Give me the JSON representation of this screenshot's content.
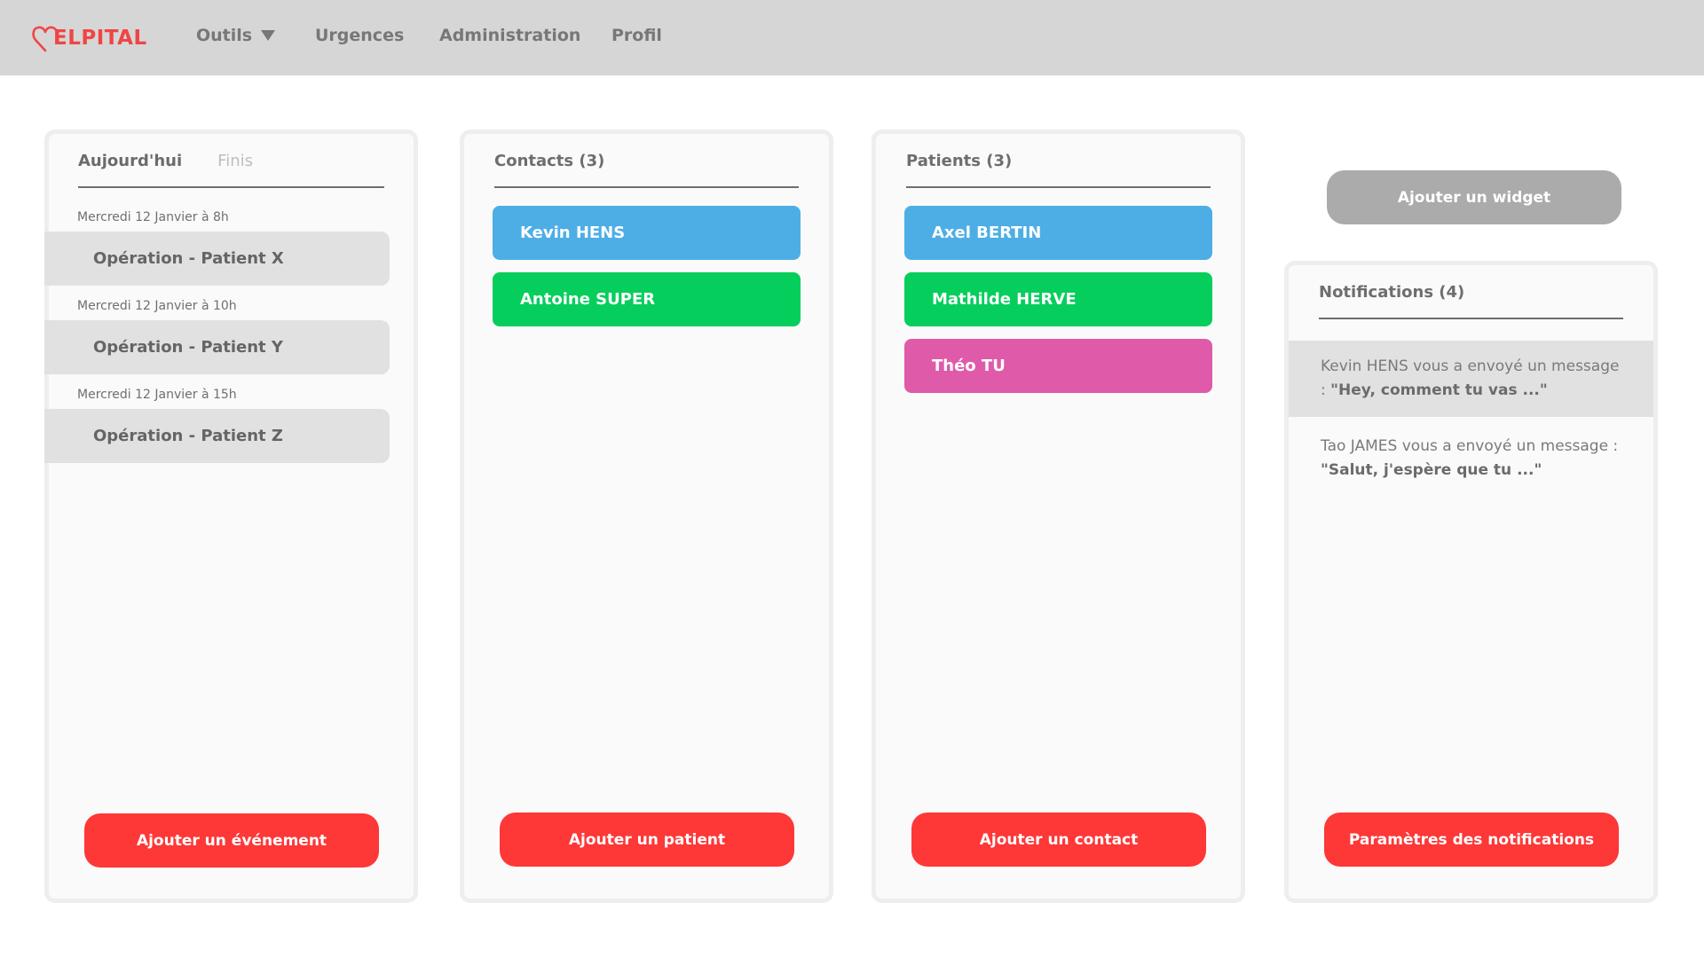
{
  "app": {
    "logo_text": "ELPITAL",
    "logo_icon": "heart-icon",
    "brand_color": "#f04545"
  },
  "nav": {
    "items": [
      {
        "label": "Outils",
        "has_dropdown": true
      },
      {
        "label": "Urgences"
      },
      {
        "label": "Administration"
      },
      {
        "label": "Profil"
      }
    ]
  },
  "events_panel": {
    "tabs": [
      {
        "label": "Aujourd'hui",
        "active": true
      },
      {
        "label": "Finis",
        "active": false
      }
    ],
    "events": [
      {
        "date": "Mercredi 12 Janvier à 8h",
        "title": "Opération - Patient X"
      },
      {
        "date": "Mercredi 12 Janvier à 10h",
        "title": "Opération - Patient Y"
      },
      {
        "date": "Mercredi 12 Janvier à 15h",
        "title": "Opération - Patient Z"
      }
    ],
    "button_label": "Ajouter un événement"
  },
  "contacts_panel": {
    "title": "Contacts (3)",
    "items": [
      {
        "name": "Kevin HENS",
        "color": "#4daee6"
      },
      {
        "name": "Antoine SUPER",
        "color": "#06ce5c"
      }
    ],
    "button_label": "Ajouter un patient"
  },
  "patients_panel": {
    "title": "Patients (3)",
    "items": [
      {
        "name": "Axel BERTIN",
        "color": "#4daee6"
      },
      {
        "name": "Mathilde HERVE",
        "color": "#06ce5c"
      },
      {
        "name": "Théo TU",
        "color": "#df5ba9"
      }
    ],
    "button_label": "Ajouter un contact"
  },
  "add_widget_label": "Ajouter un widget",
  "notifications_panel": {
    "title": "Notifications (4)",
    "items": [
      {
        "text": "Kevin HENS vous a envoyé un message : ",
        "quote": "\"Hey, comment tu vas ...\"",
        "highlighted": true
      },
      {
        "text": "Tao JAMES vous a envoyé un message : ",
        "quote": "\"Salut, j'espère que tu ...\"",
        "highlighted": false
      }
    ],
    "button_label": "Paramètres des notifications"
  },
  "colors": {
    "action_red": "#fe3737",
    "header_bg": "#d6d6d6",
    "widget_button": "#ababab"
  }
}
